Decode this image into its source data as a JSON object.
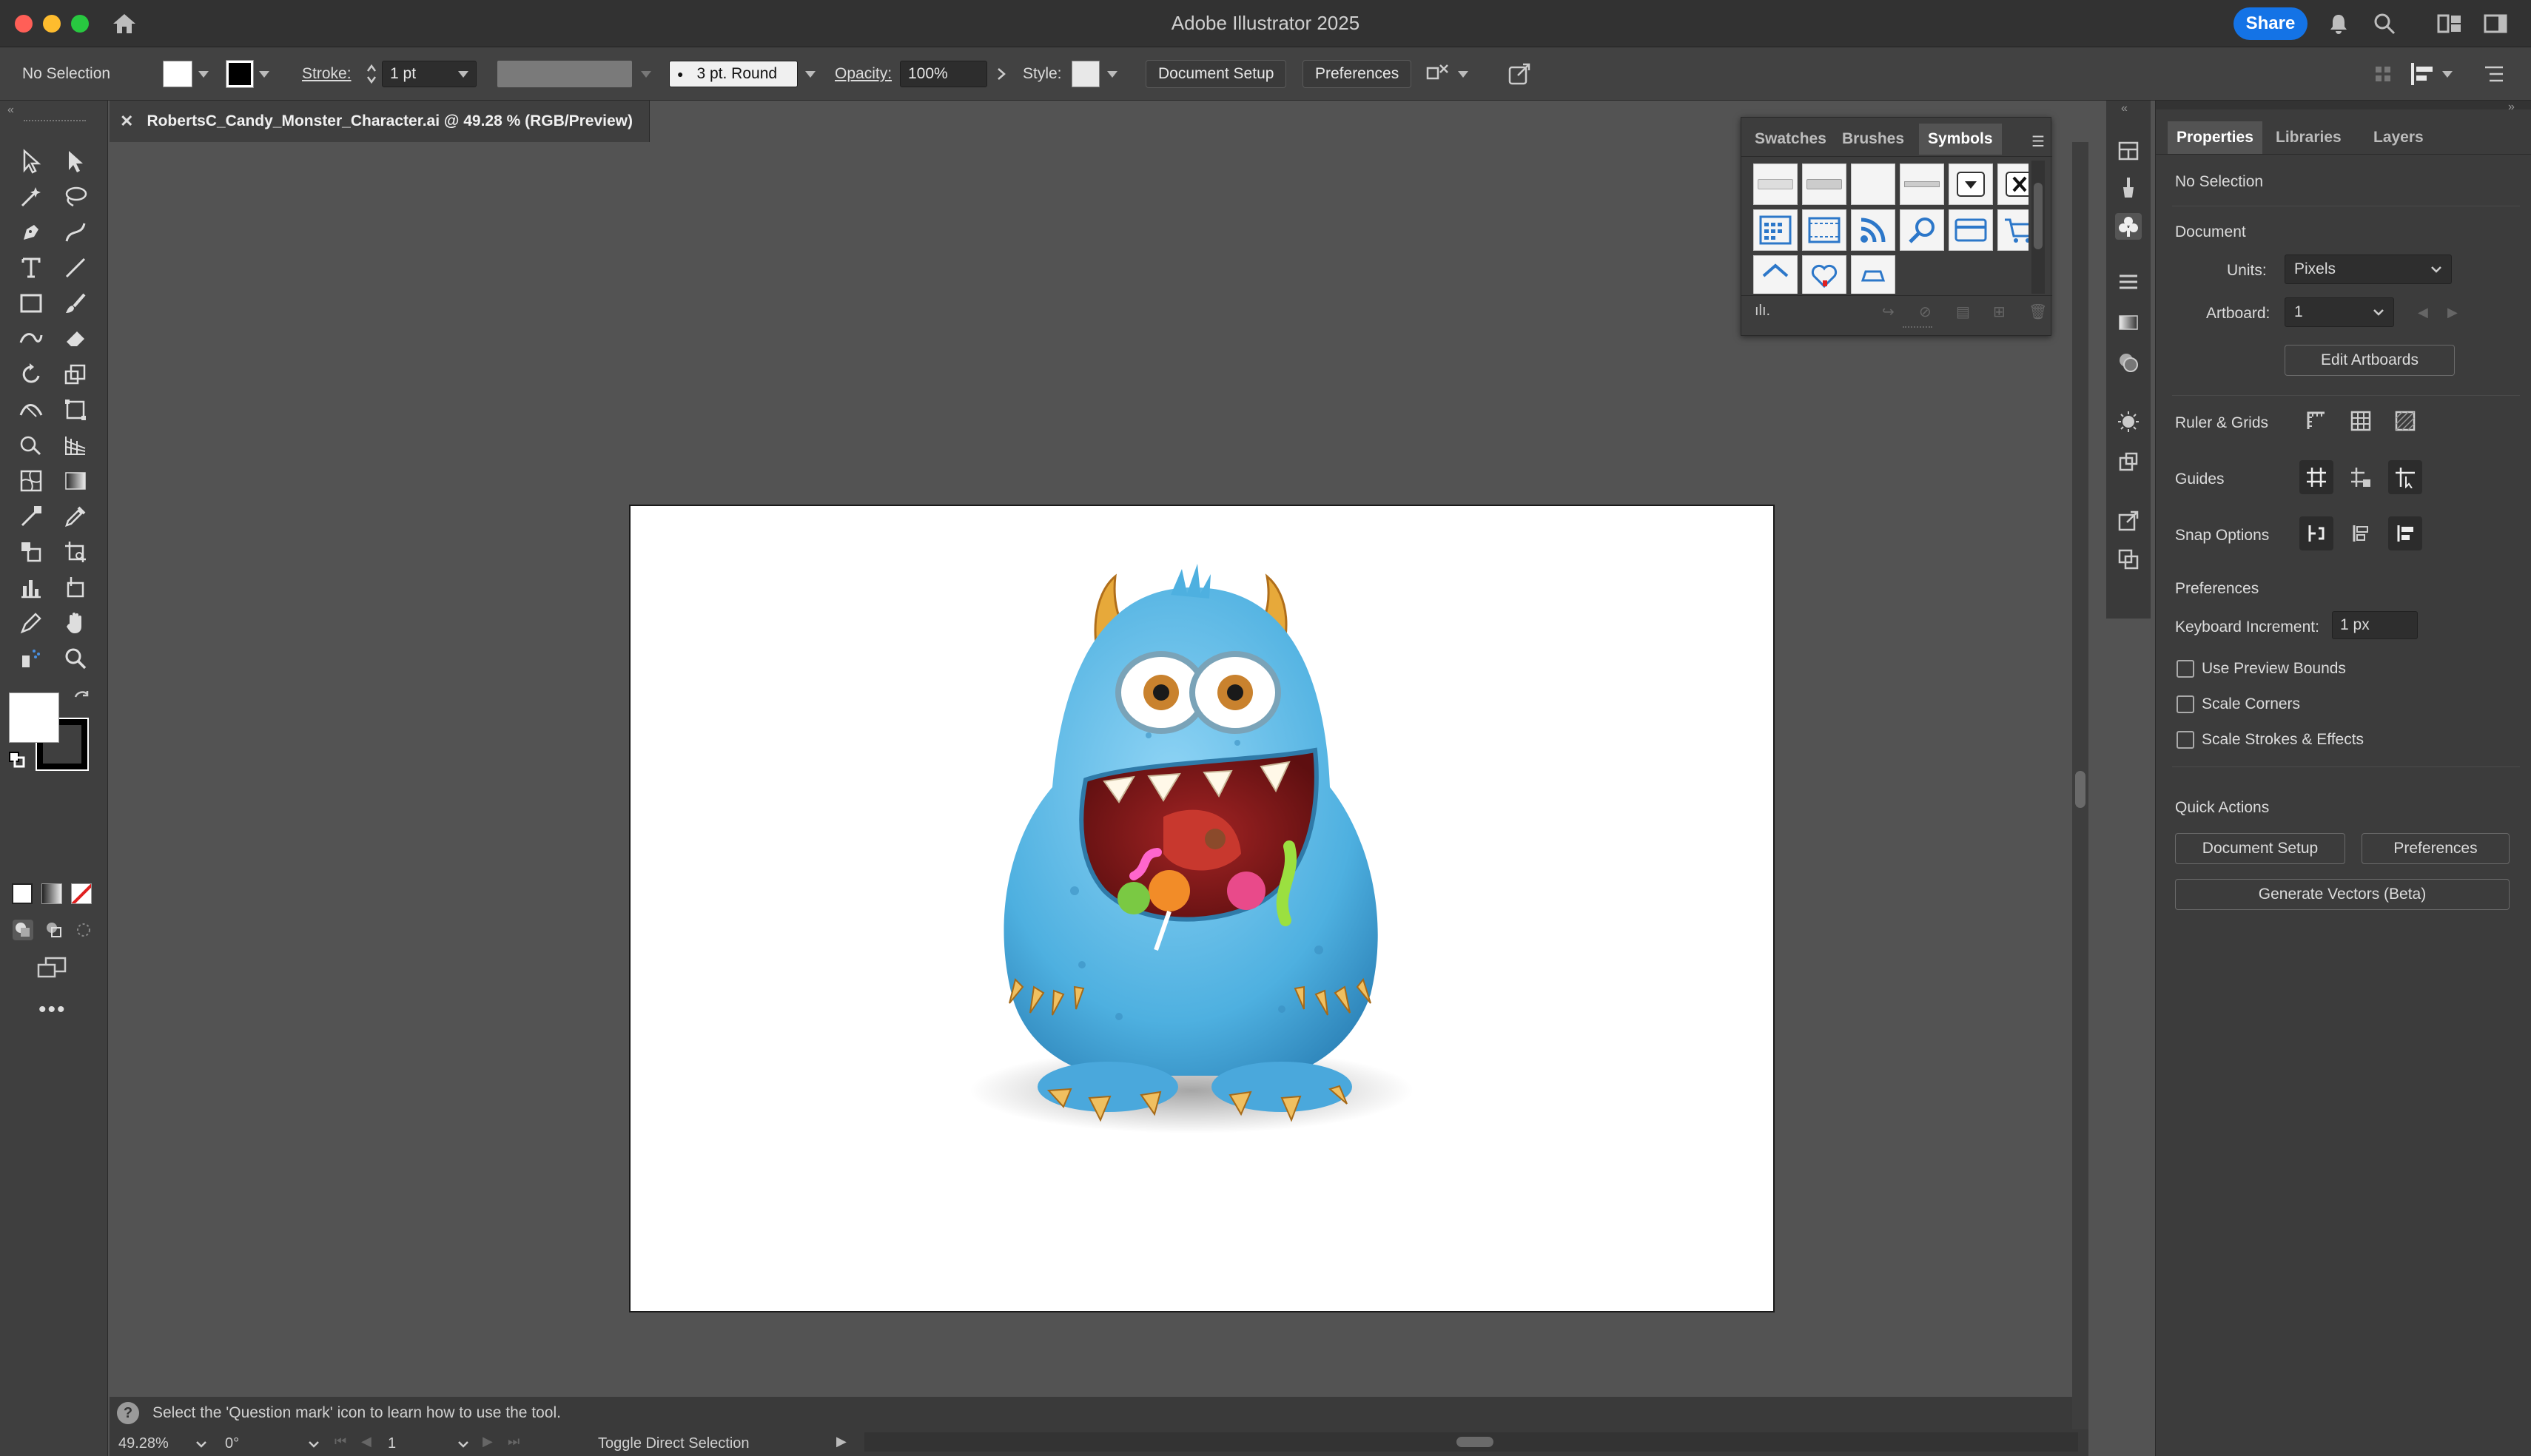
{
  "app": {
    "title": "Adobe Illustrator 2025",
    "share_label": "Share"
  },
  "controlbar": {
    "selection": "No Selection",
    "stroke_label": "Stroke:",
    "stroke_value": "1 pt",
    "brush_value": "3 pt. Round",
    "opacity_label": "Opacity:",
    "opacity_value": "100%",
    "style_label": "Style:",
    "document_setup": "Document Setup",
    "preferences": "Preferences"
  },
  "document": {
    "tab_title": "RobertsC_Candy_Monster_Character.ai @ 49.28 % (RGB/Preview)"
  },
  "symbols_panel": {
    "tabs": [
      "Swatches",
      "Brushes",
      "Symbols"
    ],
    "active_tab": "Symbols"
  },
  "properties": {
    "tabs": [
      "Properties",
      "Libraries",
      "Layers"
    ],
    "selection": "No Selection",
    "document_heading": "Document",
    "units_label": "Units:",
    "units_value": "Pixels",
    "artboard_label": "Artboard:",
    "artboard_value": "1",
    "edit_artboards": "Edit Artboards",
    "ruler_grids": "Ruler & Grids",
    "guides": "Guides",
    "snap_options": "Snap Options",
    "preferences_heading": "Preferences",
    "keyboard_increment_label": "Keyboard Increment:",
    "keyboard_increment_value": "1 px",
    "checkboxes": [
      "Use Preview Bounds",
      "Scale Corners",
      "Scale Strokes & Effects"
    ],
    "quick_actions": "Quick Actions",
    "qa_document_setup": "Document Setup",
    "qa_preferences": "Preferences",
    "generate_vectors": "Generate Vectors (Beta)"
  },
  "status": {
    "hint": "Select the 'Question mark' icon to learn how to use the tool.",
    "zoom": "49.28%",
    "rotation": "0°",
    "artboard_num": "1",
    "mode": "Toggle Direct Selection"
  },
  "colors": {
    "accent": "#1473e6",
    "monster_body": "#5bb8e6",
    "mouth": "#8b1e1e"
  }
}
